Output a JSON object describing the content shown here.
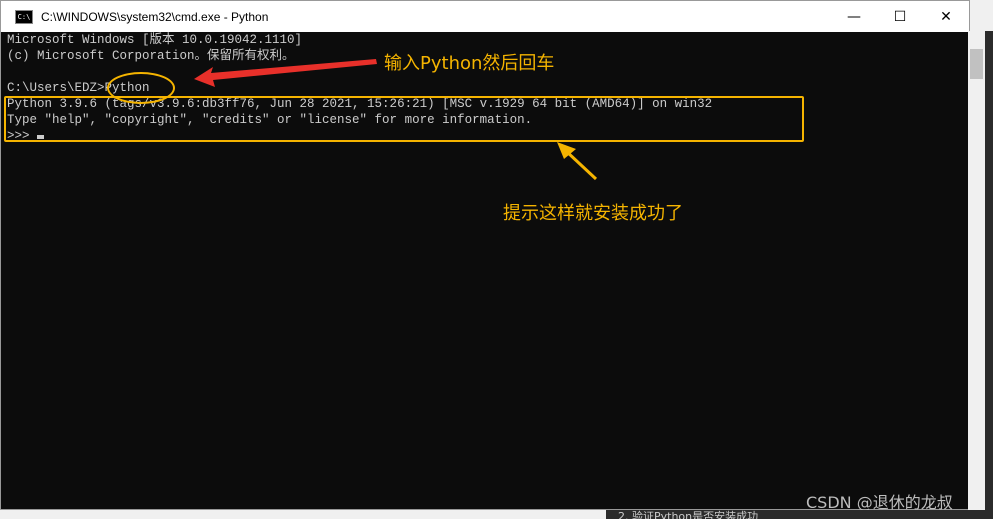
{
  "window": {
    "title": "C:\\WINDOWS\\system32\\cmd.exe - Python",
    "icon": "cmd-icon",
    "controls": [
      "minimize",
      "maximize",
      "close"
    ]
  },
  "terminal": {
    "lines": [
      "Microsoft Windows [版本 10.0.19042.1110]",
      "(c) Microsoft Corporation。保留所有权利。",
      "",
      "C:\\Users\\EDZ>Python",
      "Python 3.9.6 (tags/v3.9.6:db3ff76, Jun 28 2021, 15:26:21) [MSC v.1929 64 bit (AMD64)] on win32",
      "Type \"help\", \"copyright\", \"credits\" or \"license\" for more information.",
      ">>> "
    ]
  },
  "annotations": {
    "arrow_note": "输入Python然后回车",
    "box_note": "提示这样就安装成功了",
    "color": "#f5b400",
    "arrow_color": "#e8302a"
  },
  "watermark": "CSDN @退休的龙叔",
  "background_text": "2. 验证Python是否安装成功"
}
